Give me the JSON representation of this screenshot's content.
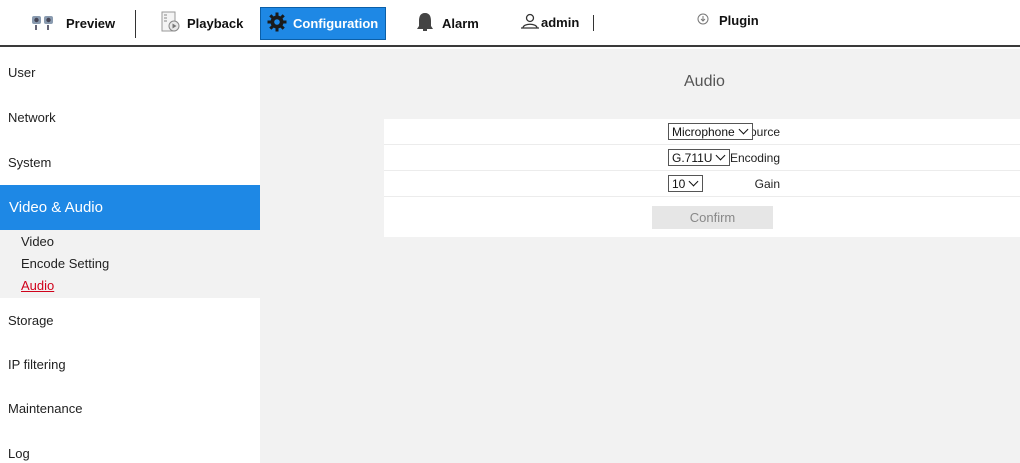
{
  "topnav": {
    "preview": "Preview",
    "playback": "Playback",
    "configuration": "Configuration",
    "alarm": "Alarm",
    "user": "admin",
    "plugin": "Plugin"
  },
  "sidebar": {
    "items": [
      "User",
      "Network",
      "System",
      "Video & Audio",
      "Storage",
      "IP filtering",
      "Maintenance",
      "Log"
    ],
    "sub_items": [
      "Video",
      "Encode Setting",
      "Audio"
    ]
  },
  "main": {
    "title": "Audio",
    "fields": [
      {
        "label": "Source",
        "value": "Microphone"
      },
      {
        "label": "Audio Encoding",
        "value": "G.711U"
      },
      {
        "label": "Gain",
        "value": "10"
      }
    ],
    "confirm_label": "Confirm"
  },
  "colors": {
    "accent": "#1e88e5",
    "active_link": "#d0021b",
    "content_bg": "#f2f2f2"
  }
}
